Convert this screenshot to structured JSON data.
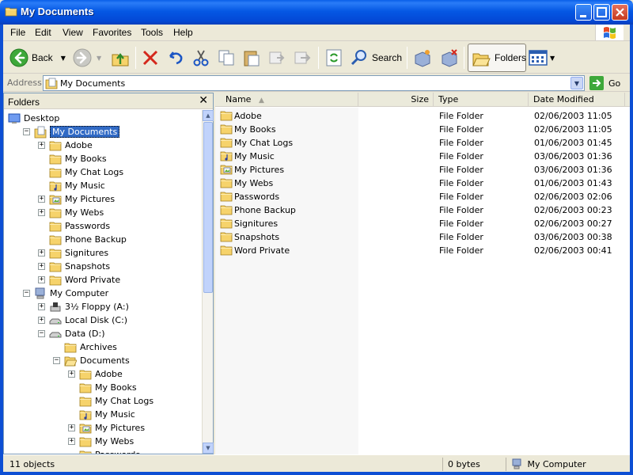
{
  "window": {
    "title": "My Documents"
  },
  "menu": [
    "File",
    "Edit",
    "View",
    "Favorites",
    "Tools",
    "Help"
  ],
  "toolbar": {
    "back_label": "Back",
    "search_label": "Search",
    "folders_label": "Folders"
  },
  "address": {
    "label": "Address",
    "value": "My Documents",
    "go_label": "Go"
  },
  "folders_pane": {
    "title": "Folders",
    "close_glyph": "✕",
    "tree": [
      {
        "label": "Desktop",
        "depth": 0,
        "expander": "none",
        "icon": "desktop-icon"
      },
      {
        "label": "My Documents",
        "depth": 1,
        "expander": "minus",
        "icon": "my-documents-icon",
        "selected": true
      },
      {
        "label": "Adobe",
        "depth": 2,
        "expander": "plus",
        "icon": "folder-icon"
      },
      {
        "label": "My Books",
        "depth": 2,
        "expander": "none",
        "icon": "folder-icon"
      },
      {
        "label": "My Chat Logs",
        "depth": 2,
        "expander": "none",
        "icon": "folder-icon"
      },
      {
        "label": "My Music",
        "depth": 2,
        "expander": "none",
        "icon": "music-folder-icon"
      },
      {
        "label": "My Pictures",
        "depth": 2,
        "expander": "plus",
        "icon": "pictures-folder-icon"
      },
      {
        "label": "My Webs",
        "depth": 2,
        "expander": "plus",
        "icon": "folder-icon"
      },
      {
        "label": "Passwords",
        "depth": 2,
        "expander": "none",
        "icon": "folder-icon"
      },
      {
        "label": "Phone Backup",
        "depth": 2,
        "expander": "none",
        "icon": "folder-icon"
      },
      {
        "label": "Signitures",
        "depth": 2,
        "expander": "plus",
        "icon": "folder-icon"
      },
      {
        "label": "Snapshots",
        "depth": 2,
        "expander": "plus",
        "icon": "folder-icon"
      },
      {
        "label": "Word Private",
        "depth": 2,
        "expander": "plus",
        "icon": "folder-icon"
      },
      {
        "label": "My Computer",
        "depth": 1,
        "expander": "minus",
        "icon": "my-computer-icon"
      },
      {
        "label": "3½ Floppy (A:)",
        "depth": 2,
        "expander": "plus",
        "icon": "floppy-drive-icon"
      },
      {
        "label": "Local Disk (C:)",
        "depth": 2,
        "expander": "plus",
        "icon": "hard-disk-icon"
      },
      {
        "label": "Data (D:)",
        "depth": 2,
        "expander": "minus",
        "icon": "hard-disk-icon"
      },
      {
        "label": "Archives",
        "depth": 3,
        "expander": "none",
        "icon": "folder-icon"
      },
      {
        "label": "Documents",
        "depth": 3,
        "expander": "minus",
        "icon": "folder-open-icon"
      },
      {
        "label": "Adobe",
        "depth": 4,
        "expander": "plus",
        "icon": "folder-icon"
      },
      {
        "label": "My Books",
        "depth": 4,
        "expander": "none",
        "icon": "folder-icon"
      },
      {
        "label": "My Chat Logs",
        "depth": 4,
        "expander": "none",
        "icon": "folder-icon"
      },
      {
        "label": "My Music",
        "depth": 4,
        "expander": "none",
        "icon": "music-folder-icon"
      },
      {
        "label": "My Pictures",
        "depth": 4,
        "expander": "plus",
        "icon": "pictures-folder-icon"
      },
      {
        "label": "My Webs",
        "depth": 4,
        "expander": "plus",
        "icon": "folder-icon"
      },
      {
        "label": "Passwords",
        "depth": 4,
        "expander": "none",
        "icon": "folder-icon"
      }
    ]
  },
  "file_list": {
    "columns": [
      "Name",
      "Size",
      "Type",
      "Date Modified"
    ],
    "rows": [
      {
        "name": "Adobe",
        "size": "",
        "type": "File Folder",
        "date": "02/06/2003 11:05",
        "icon": "folder-icon"
      },
      {
        "name": "My Books",
        "size": "",
        "type": "File Folder",
        "date": "02/06/2003 11:05",
        "icon": "folder-icon"
      },
      {
        "name": "My Chat Logs",
        "size": "",
        "type": "File Folder",
        "date": "01/06/2003 01:45",
        "icon": "folder-icon"
      },
      {
        "name": "My Music",
        "size": "",
        "type": "File Folder",
        "date": "03/06/2003 01:36",
        "icon": "music-folder-icon"
      },
      {
        "name": "My Pictures",
        "size": "",
        "type": "File Folder",
        "date": "03/06/2003 01:36",
        "icon": "pictures-folder-icon"
      },
      {
        "name": "My Webs",
        "size": "",
        "type": "File Folder",
        "date": "01/06/2003 01:43",
        "icon": "folder-icon"
      },
      {
        "name": "Passwords",
        "size": "",
        "type": "File Folder",
        "date": "02/06/2003 02:06",
        "icon": "folder-icon"
      },
      {
        "name": "Phone Backup",
        "size": "",
        "type": "File Folder",
        "date": "02/06/2003 00:23",
        "icon": "folder-icon"
      },
      {
        "name": "Signitures",
        "size": "",
        "type": "File Folder",
        "date": "02/06/2003 00:27",
        "icon": "folder-icon"
      },
      {
        "name": "Snapshots",
        "size": "",
        "type": "File Folder",
        "date": "03/06/2003 00:38",
        "icon": "folder-icon"
      },
      {
        "name": "Word Private",
        "size": "",
        "type": "File Folder",
        "date": "02/06/2003 00:41",
        "icon": "folder-icon"
      }
    ]
  },
  "status": {
    "objects": "11 objects",
    "size": "0 bytes",
    "location": "My Computer"
  },
  "colors": {
    "titlebar": "#0558e4",
    "selection": "#316ac5",
    "chrome": "#ece9d8"
  }
}
